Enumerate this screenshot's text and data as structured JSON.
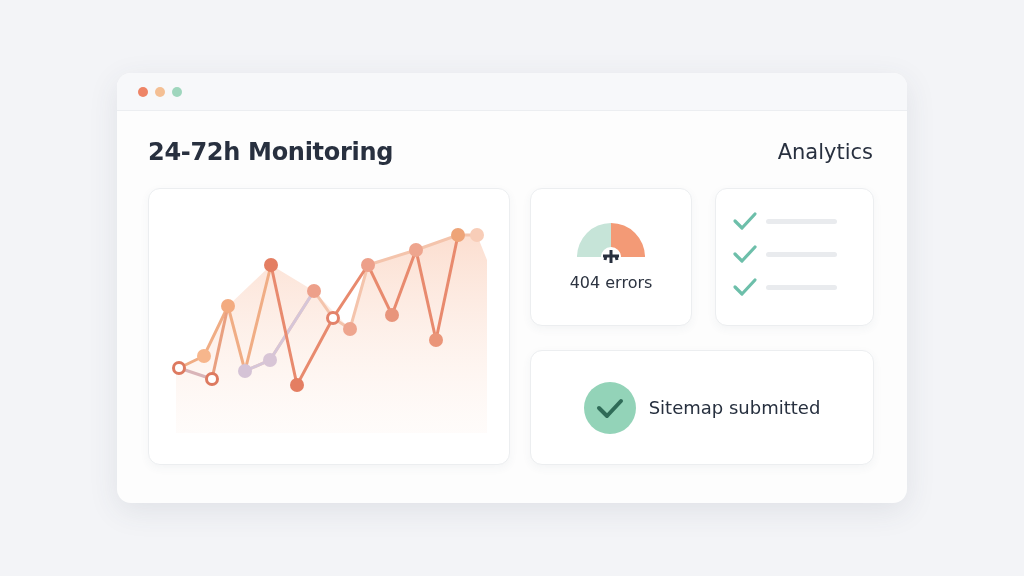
{
  "window": {
    "title": "24-72h Monitoring",
    "section": "Analytics"
  },
  "errors_card": {
    "label": "404 errors"
  },
  "checklist": [
    {
      "checked": true
    },
    {
      "checked": true
    },
    {
      "checked": true
    }
  ],
  "status_card": {
    "label": "Sitemap submitted",
    "done": true
  }
}
